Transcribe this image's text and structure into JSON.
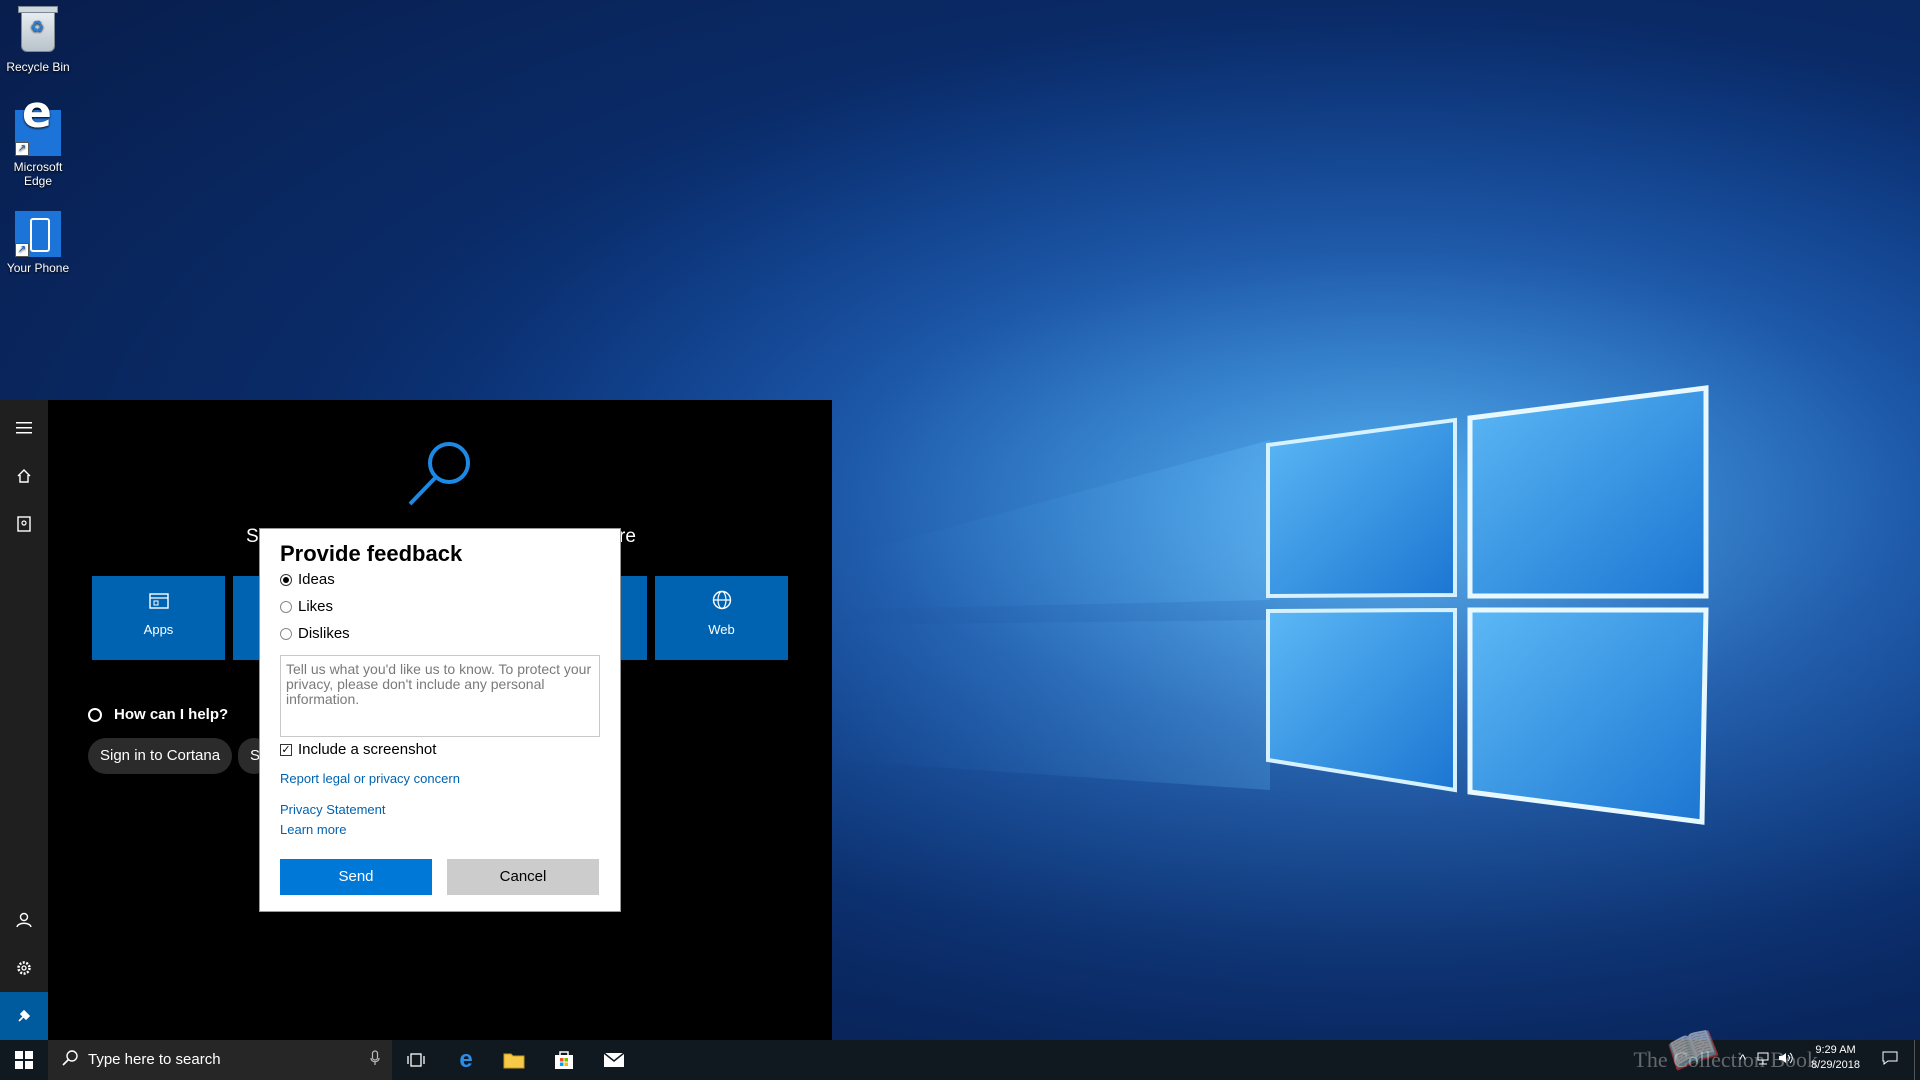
{
  "desktop": {
    "icons": [
      {
        "label": "Recycle Bin"
      },
      {
        "label": "Microsoft Edge"
      },
      {
        "label": "Your Phone"
      }
    ]
  },
  "search_panel": {
    "heading_start": "Se",
    "heading_end": "re",
    "filters": [
      {
        "label": "Apps",
        "icon": "apps-icon"
      },
      {
        "label": "Web",
        "icon": "globe-icon"
      }
    ],
    "help_prompt": "How can I help?",
    "pills": [
      "Sign in to Cortana",
      "S"
    ]
  },
  "feedback_dialog": {
    "title": "Provide feedback",
    "options": [
      {
        "label": "Ideas",
        "selected": true
      },
      {
        "label": "Likes",
        "selected": false
      },
      {
        "label": "Dislikes",
        "selected": false
      }
    ],
    "textarea_placeholder": "Tell us what you'd like us to know. To protect your privacy, please don't include any personal information.",
    "include_screenshot_label": "Include a screenshot",
    "include_screenshot_checked": true,
    "links": {
      "report": "Report legal or privacy concern",
      "privacy": "Privacy Statement",
      "learn_more": "Learn more"
    },
    "send_label": "Send",
    "cancel_label": "Cancel"
  },
  "taskbar": {
    "search_placeholder": "Type here to search",
    "clock_time": "9:29 AM",
    "clock_date": "8/29/2018",
    "watermark": "The Collection Book"
  },
  "colors": {
    "accent": "#0078d7",
    "tile": "#0063b1",
    "rail_active": "#005a9e"
  }
}
